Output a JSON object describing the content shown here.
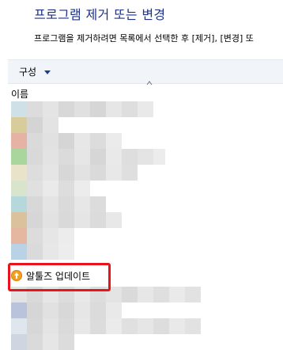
{
  "header": {
    "title": "프로그램 제거 또는 변경",
    "subtitle": "프로그램을 제거하려면 목록에서 선택한 후 [제거], [변경] 또"
  },
  "toolbar": {
    "organize_label": "구성"
  },
  "columns": {
    "name": "이름"
  },
  "highlighted_item": {
    "label": "알툴즈 업데이트"
  },
  "colors": {
    "title": "#1e3287",
    "toolbar_bg": "#f1f4f9",
    "highlight_border": "#e8141a",
    "update_icon": "#f0a020"
  }
}
